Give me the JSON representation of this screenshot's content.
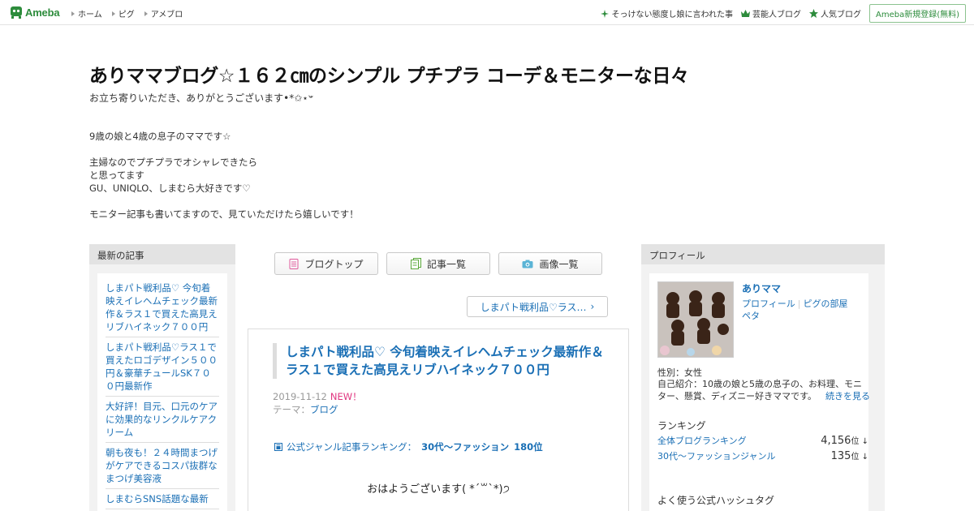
{
  "topbar": {
    "logo_text": "Ameba",
    "nav": [
      "ホーム",
      "ピグ",
      "アメブロ"
    ],
    "right_links": [
      {
        "label": "そっけない態度し娘に言われた事",
        "icon": "sparkle-icon"
      },
      {
        "label": "芸能人ブログ",
        "icon": "crown-icon"
      },
      {
        "label": "人気ブログ",
        "icon": "star-icon"
      }
    ],
    "register_label": "Ameba新規登録(無料)"
  },
  "header": {
    "title": "ありママブログ☆１６２㎝のシンプル プチプラ コーデ＆モニターな日々",
    "subtitle": "お立ち寄りいただき、ありがとうございます•*✩⋆𐤔",
    "description": [
      "9歳の娘と4歳の息子のママです☆",
      "",
      "主婦なのでプチプラでオシャレできたら",
      "と思ってます",
      "GU、UNIQLO、しまむら大好きです♡",
      "",
      "モニター記事も書いてますので、見ていただけたら嬉しいです！"
    ]
  },
  "left": {
    "heading": "最新の記事",
    "items": [
      "しまパト戦利品♡ 今旬着映えイレヘムチェック最新作＆ラス１で買えた高見えリブハイネック７００円",
      "しまパト戦利品♡ラス１で買えたロゴデザイン５００円＆豪華チュールSK７００円最新作",
      "大好評！目元、口元のケアに効果的なリンクルケアクリーム",
      "朝も夜も！２４時間まつげがケアできるコスパ抜群なまつげ美容液",
      "しまむらSNS話題な最新"
    ]
  },
  "center": {
    "buttons": [
      {
        "label": "ブログトップ",
        "icon": "blog-top-icon"
      },
      {
        "label": "記事一覧",
        "icon": "article-list-icon"
      },
      {
        "label": "画像一覧",
        "icon": "camera-icon"
      }
    ],
    "next_article_label": "しまパト戦利品♡ラス…",
    "article": {
      "title": "しまパト戦利品♡ 今旬着映えイレヘムチェック最新作＆ラス１で買えた高見えリブハイネック７００円",
      "date": "2019-11-12",
      "new_badge": "NEW！",
      "theme_prefix": "テーマ：",
      "theme": "ブログ",
      "ranking_label": "公式ジャンル記事ランキング：",
      "ranking_genre": "30代〜ファッション",
      "ranking_value": "180位",
      "body_first_line": "おはようございます( *´꒳`*)੭"
    }
  },
  "right": {
    "heading": "プロフィール",
    "name": "ありママ",
    "link_profile": "プロフィール",
    "link_pigg": "ピグの部屋",
    "link_peta": "ペタ",
    "gender": "性別：女性",
    "intro": "自己紹介：10歳の娘と5歳の息子の、お料理、モニター、懸賞、ディズニー好きママです。",
    "more": "続きを見る",
    "ranking_title": "ランキング",
    "rankings": [
      {
        "label": "全体ブログランキング",
        "value": "4,156",
        "unit": "位 ↓"
      },
      {
        "label": "30代〜ファッションジャンル",
        "value": "135",
        "unit": "位 ↓"
      }
    ],
    "hashtag_title": "よく使う公式ハッシュタグ"
  },
  "colors": {
    "accent_green": "#2d8c3c",
    "link_blue": "#1a6fb5",
    "new_pink": "#e03680"
  }
}
